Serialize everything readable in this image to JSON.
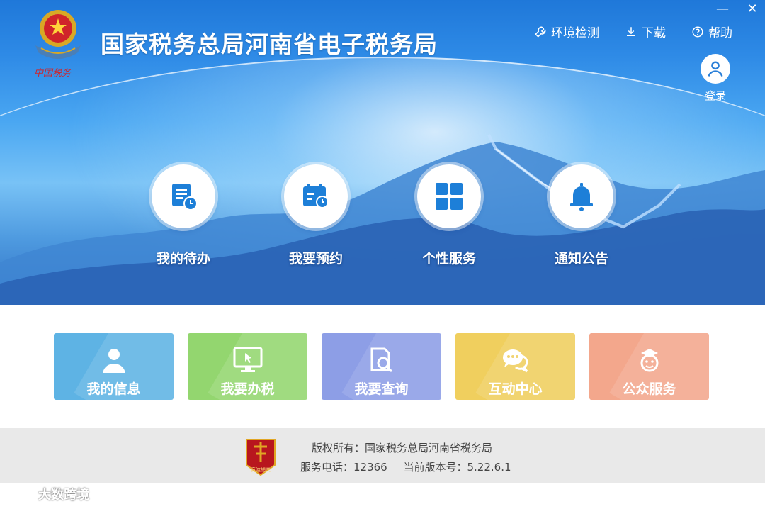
{
  "app": {
    "title": "国家税务总局河南省电子税务局",
    "emblem_caption": "中国税务"
  },
  "window": {
    "minimize": "—",
    "close": "✕"
  },
  "top_links": [
    {
      "label": "环境检测",
      "icon": "wrench-icon"
    },
    {
      "label": "下载",
      "icon": "download-icon"
    },
    {
      "label": "帮助",
      "icon": "help-icon"
    }
  ],
  "login": {
    "label": "登录"
  },
  "main_actions": [
    {
      "label": "我的待办",
      "icon": "todo-icon"
    },
    {
      "label": "我要预约",
      "icon": "calendar-icon"
    },
    {
      "label": "个性服务",
      "icon": "grid-icon"
    },
    {
      "label": "通知公告",
      "icon": "bell-icon"
    }
  ],
  "tiles": [
    {
      "label": "我的信息",
      "icon": "user-icon",
      "color": "#5eb3e4"
    },
    {
      "label": "我要办税",
      "icon": "monitor-icon",
      "color": "#93d66f"
    },
    {
      "label": "我要查询",
      "icon": "search-doc-icon",
      "color": "#8d9ee6"
    },
    {
      "label": "互动中心",
      "icon": "chat-icon",
      "color": "#f0cf5e"
    },
    {
      "label": "公众服务",
      "icon": "face-icon",
      "color": "#f3a78c"
    }
  ],
  "footer": {
    "copyright": "版权所有：国家税务总局河南省税务局",
    "phone": "服务电话：12366",
    "version": "当前版本号：5.22.6.1",
    "badge_text": "竞渡辅关"
  },
  "watermark": {
    "text": "大数跨境"
  }
}
